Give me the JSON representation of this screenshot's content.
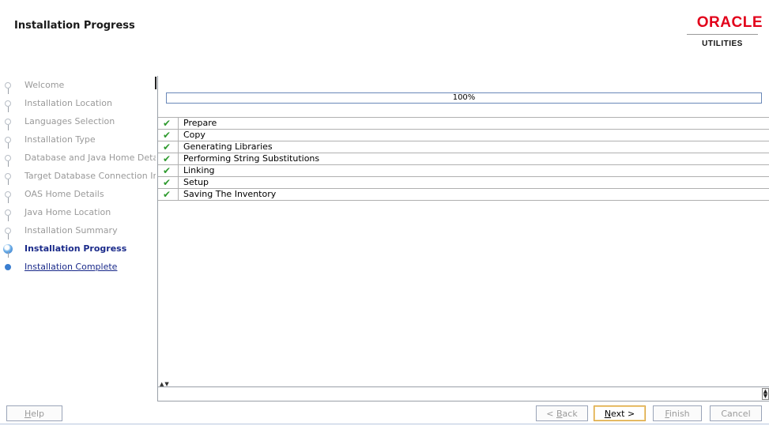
{
  "header": {
    "title": "Installation Progress"
  },
  "logo": {
    "brand": "ORACLE",
    "sub": "UTILITIES"
  },
  "nav": {
    "steps": [
      {
        "label": "Welcome",
        "state": "done"
      },
      {
        "label": "Installation Location",
        "state": "done"
      },
      {
        "label": "Languages Selection",
        "state": "done"
      },
      {
        "label": "Installation Type",
        "state": "done"
      },
      {
        "label": "Database and Java Home Details",
        "state": "done"
      },
      {
        "label": "Target Database Connection Information",
        "state": "done"
      },
      {
        "label": "OAS Home Details",
        "state": "done"
      },
      {
        "label": "Java Home Location",
        "state": "done"
      },
      {
        "label": "Installation Summary",
        "state": "done"
      },
      {
        "label": "Installation Progress",
        "state": "current"
      },
      {
        "label": "Installation Complete",
        "state": "link"
      }
    ]
  },
  "progress": {
    "percent_text": "100%",
    "value": 1.0
  },
  "tasks": [
    {
      "name": "Prepare",
      "status": "complete"
    },
    {
      "name": "Copy",
      "status": "complete"
    },
    {
      "name": "Generating Libraries",
      "status": "complete"
    },
    {
      "name": "Performing String Substitutions",
      "status": "complete"
    },
    {
      "name": "Linking",
      "status": "complete"
    },
    {
      "name": "Setup",
      "status": "complete"
    },
    {
      "name": "Saving The Inventory",
      "status": "complete"
    }
  ],
  "buttons": {
    "help": {
      "pre": "",
      "mn": "H",
      "post": "elp"
    },
    "back": {
      "pre": "< ",
      "mn": "B",
      "post": "ack"
    },
    "next": {
      "pre": "",
      "mn": "N",
      "post": "ext >"
    },
    "finish": {
      "pre": "",
      "mn": "F",
      "post": "inish"
    },
    "cancel": "Cancel"
  },
  "colors": {
    "brand": "#e2001a",
    "check": "#2e9a2e",
    "link": "#1a2a8a"
  },
  "icons": {
    "check": "check-icon",
    "step": "step-dot-icon",
    "current_step": "current-step-icon"
  }
}
